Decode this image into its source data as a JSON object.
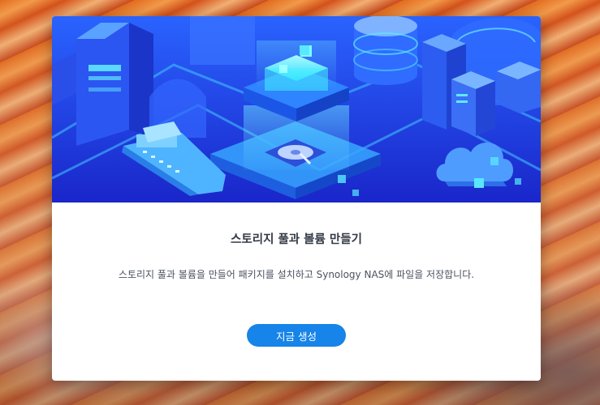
{
  "dialog": {
    "title": "스토리지 풀과 볼륨 만들기",
    "description": "스토리지 풀과 볼륨을 만들어 패키지를 설치하고 Synology NAS에 파일을 저장합니다.",
    "create_button_label": "지금 생성"
  },
  "colors": {
    "accent": "#1684e8",
    "hero_primary": "#1f3de0",
    "hero_glow": "#2ff0ff",
    "title_text": "#333a44"
  },
  "hero": {
    "icons": [
      "building-icon",
      "database-icon",
      "storage-core-icon",
      "ship-icon",
      "cloud-icon",
      "datacenter-icon",
      "disk-icon"
    ]
  }
}
